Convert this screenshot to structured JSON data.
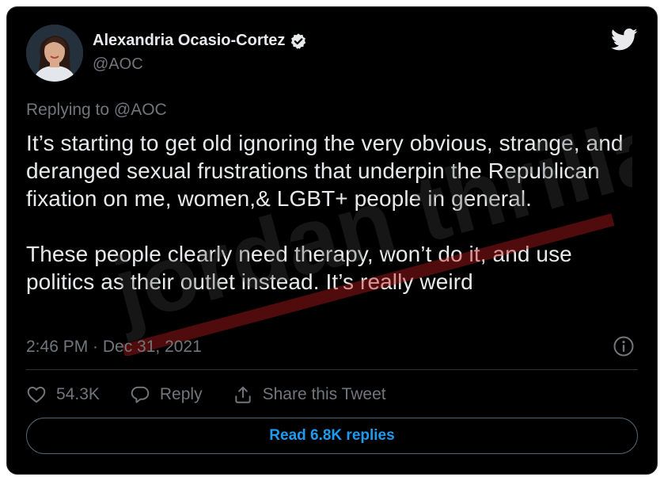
{
  "author": {
    "name": "Alexandria Ocasio-Cortez",
    "handle": "@AOC",
    "verified": true
  },
  "reply_context": "Replying to @AOC",
  "tweet": {
    "paragraph_1": "It’s starting to get old ignoring the very obvious, strange, and deranged sexual frustrations that underpin the Republican fixation on me, women,& LGBT+ people in general.",
    "paragraph_2": "These people clearly need therapy, won’t do it, and use politics as their outlet instead. It’s really weird"
  },
  "timestamp": "2:46 PM · Dec 31, 2021",
  "actions": {
    "likes": "54.3K",
    "reply_label": "Reply",
    "share_label": "Share this Tweet"
  },
  "read_replies_label": "Read 6.8K replies",
  "watermark_text": "jordan thrilla.",
  "icons": {
    "verified": "verified-badge-icon",
    "twitter": "twitter-bird-icon",
    "info": "info-icon",
    "like": "heart-icon",
    "reply": "speech-bubble-icon",
    "share": "share-arrow-icon"
  },
  "colors": {
    "background": "#000000",
    "text": "#e7e9ea",
    "secondary_text": "#71767b",
    "accent": "#1d9bf0",
    "watermark": "#c41e1e"
  }
}
